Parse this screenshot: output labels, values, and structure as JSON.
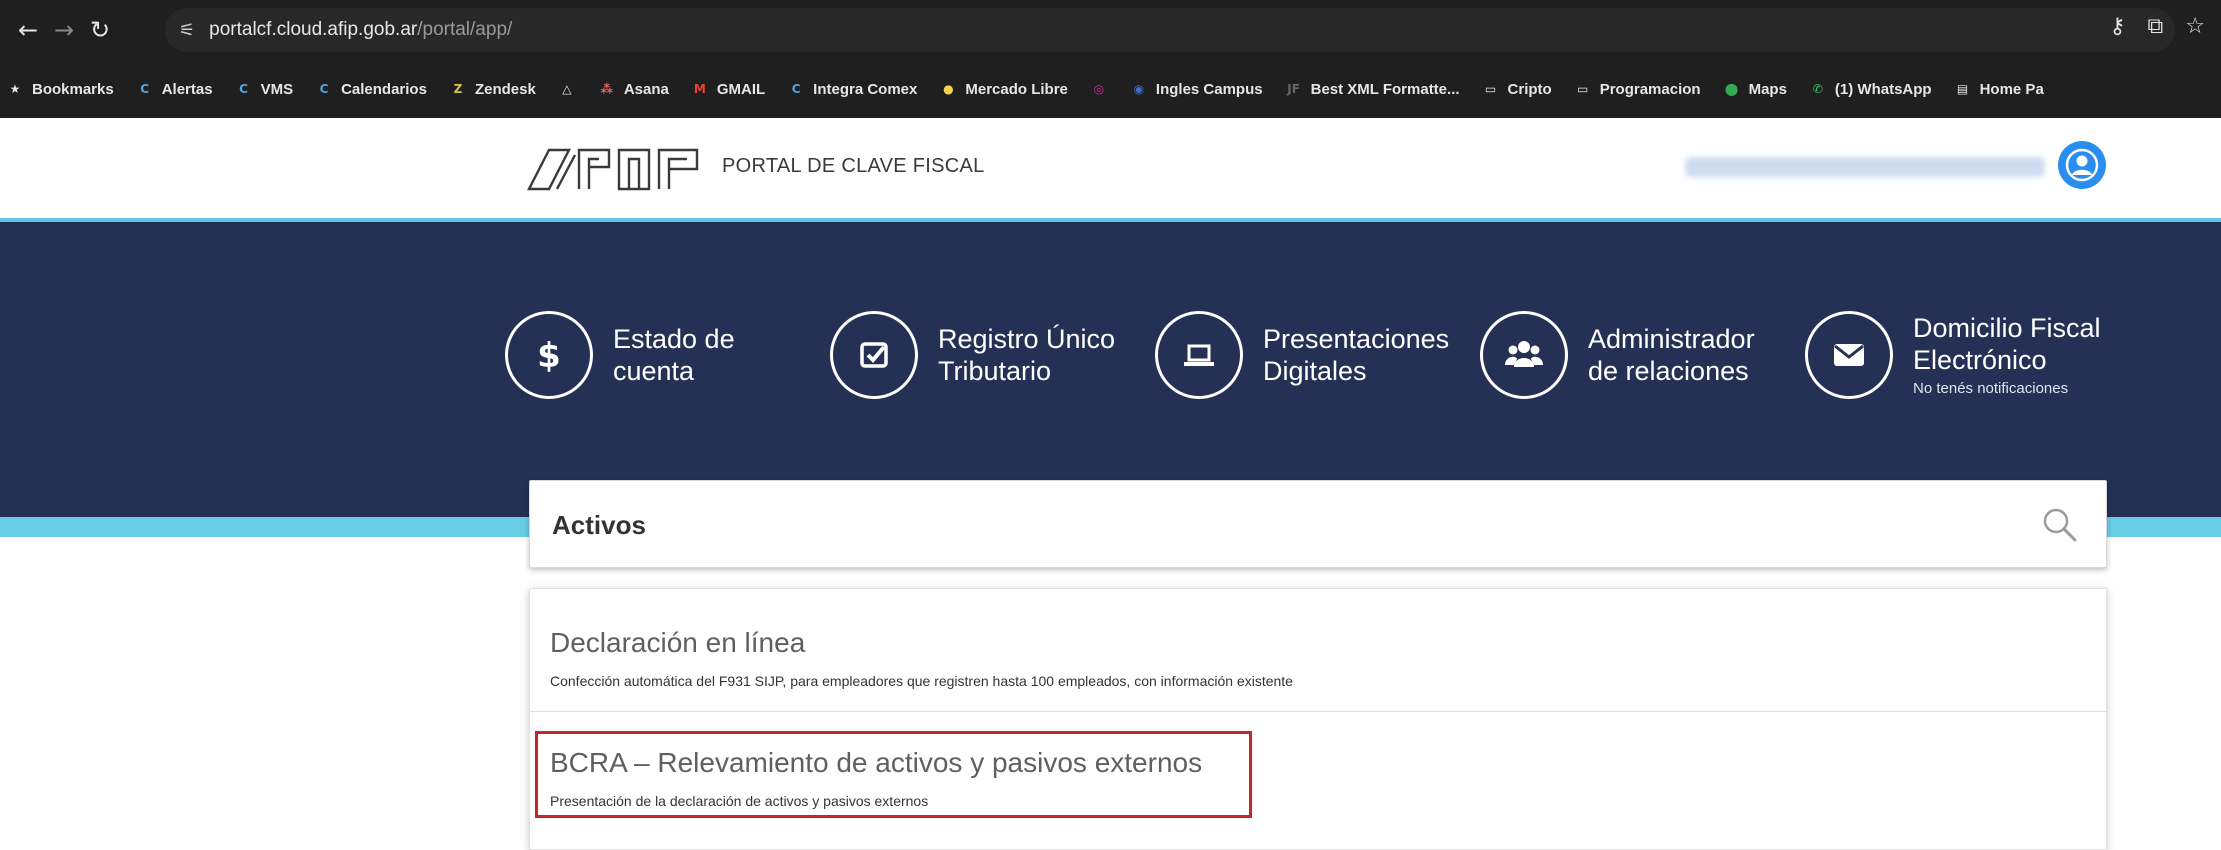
{
  "browser": {
    "url_host": "portalcf.cloud.afip.gob.ar",
    "url_path": "/portal/app/",
    "bookmarks": [
      {
        "label": "Bookmarks",
        "icon": "star-icon",
        "color": "#e6e6e6"
      },
      {
        "label": "Alertas",
        "icon": "c-logo-icon",
        "color": "#4ea3e0"
      },
      {
        "label": "VMS",
        "icon": "c-logo-icon",
        "color": "#4ea3e0"
      },
      {
        "label": "Calendarios",
        "icon": "c-logo-icon",
        "color": "#4ea3e0"
      },
      {
        "label": "Zendesk",
        "icon": "zendesk-icon",
        "color": "#d6c24a"
      },
      {
        "label": "",
        "icon": "triangle-icon",
        "color": "#e6e6e6"
      },
      {
        "label": "Asana",
        "icon": "asana-icon",
        "color": "#f06a6a"
      },
      {
        "label": "GMAIL",
        "icon": "gmail-icon",
        "color": "#ea4335"
      },
      {
        "label": "Integra Comex",
        "icon": "c-logo-icon",
        "color": "#4ea3e0"
      },
      {
        "label": "Mercado Libre",
        "icon": "mercadolibre-icon",
        "color": "#f5d547"
      },
      {
        "label": "",
        "icon": "instagram-icon",
        "color": "#d6249f"
      },
      {
        "label": "Ingles Campus",
        "icon": "campus-icon",
        "color": "#3b6fd1"
      },
      {
        "label": "Best XML Formatte...",
        "icon": "xml-icon",
        "color": "#666666"
      },
      {
        "label": "Cripto",
        "icon": "folder-icon",
        "color": "#e6e6e6"
      },
      {
        "label": "Programacion",
        "icon": "folder-icon",
        "color": "#e6e6e6"
      },
      {
        "label": "Maps",
        "icon": "maps-icon",
        "color": "#34a853"
      },
      {
        "label": "(1) WhatsApp",
        "icon": "whatsapp-icon",
        "color": "#25d366"
      },
      {
        "label": "Home Pa",
        "icon": "page-icon",
        "color": "#e6e6e6"
      }
    ]
  },
  "header": {
    "portal_title": "PORTAL DE CLAVE FISCAL"
  },
  "quick_access": [
    {
      "line1": "Estado de",
      "line2": "cuenta",
      "sub": "",
      "icon": "dollar-icon"
    },
    {
      "line1": "Registro Único",
      "line2": "Tributario",
      "sub": "",
      "icon": "checkbox-icon"
    },
    {
      "line1": "Presentaciones",
      "line2": "Digitales",
      "sub": "",
      "icon": "laptop-icon"
    },
    {
      "line1": "Administrador",
      "line2": "de relaciones",
      "sub": "",
      "icon": "users-icon"
    },
    {
      "line1": "Domicilio Fiscal",
      "line2": "Electrónico",
      "sub": "No tenés notificaciones",
      "icon": "envelope-icon"
    }
  ],
  "search": {
    "value": "Activos"
  },
  "results": [
    {
      "title": "Declaración en línea",
      "description": "Confección automática del F931 SIJP, para empleadores que registren hasta 100 empleados, con información existente"
    },
    {
      "title": "BCRA – Relevamiento de activos y pasivos externos",
      "description": "Presentación de la declaración de activos y pasivos externos",
      "highlighted": true
    }
  ],
  "colors": {
    "hero": "#243154",
    "accent_teal": "#67cde6",
    "highlight_border": "#c1272d",
    "avatar": "#2a8ef0"
  }
}
